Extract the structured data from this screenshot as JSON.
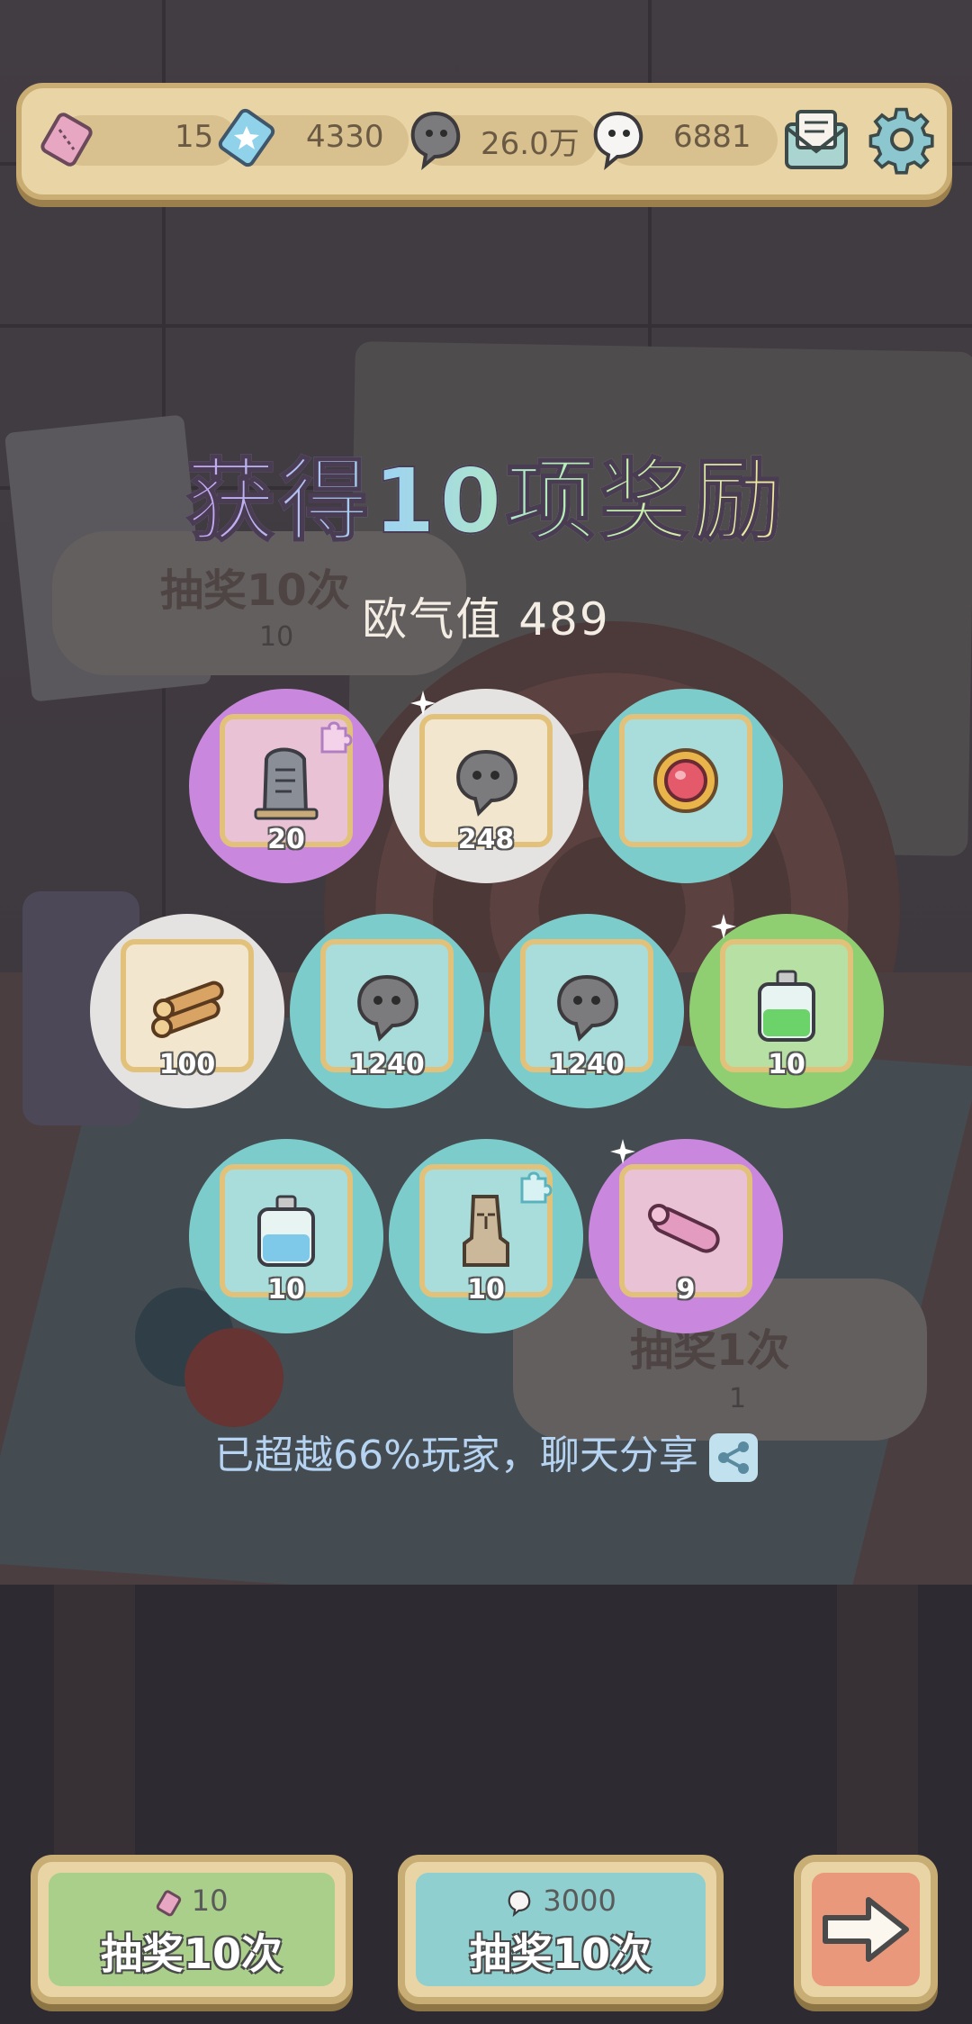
{
  "top_bar": {
    "ticket_value": "15",
    "star_ticket_value": "4330",
    "dark_bubble_value": "26.0万",
    "white_bubble_value": "6881",
    "icons": [
      "ticket-icon",
      "star-ticket-icon",
      "dark-bubble-icon",
      "white-bubble-icon",
      "mail-icon",
      "gear-icon"
    ]
  },
  "background_signs": {
    "left_title": "抽奖10次",
    "left_cost": "10",
    "right_title": "抽奖1次",
    "right_cost": "1"
  },
  "popup": {
    "title": "获得10项奖励",
    "luck_label": "欧气值 489",
    "rewards": [
      {
        "item": "stone-tablet",
        "quantity": "20",
        "rarity": "purple"
      },
      {
        "item": "dark-bubble",
        "quantity": "248",
        "rarity": "white"
      },
      {
        "item": "gem-brooch",
        "quantity": "",
        "rarity": "teal"
      },
      {
        "item": "wood-logs",
        "quantity": "100",
        "rarity": "white"
      },
      {
        "item": "dark-bubble",
        "quantity": "1240",
        "rarity": "teal"
      },
      {
        "item": "dark-bubble",
        "quantity": "1240",
        "rarity": "teal"
      },
      {
        "item": "green-potion",
        "quantity": "10",
        "rarity": "green"
      },
      {
        "item": "blue-potion",
        "quantity": "10",
        "rarity": "teal"
      },
      {
        "item": "moai-statue",
        "quantity": "10",
        "rarity": "teal"
      },
      {
        "item": "pink-scroll",
        "quantity": "9",
        "rarity": "purple"
      }
    ],
    "share_text": "已超越66%玩家，聊天分享"
  },
  "buttons": {
    "draw_ticket": {
      "cost": "10",
      "label": "抽奖10次"
    },
    "draw_bubble": {
      "cost": "3000",
      "label": "抽奖10次"
    }
  },
  "colors": {
    "purple": "#c987dd",
    "white": "#e5e3e2",
    "teal": "#7dcccc",
    "green": "#8fcf72",
    "panel": "#e9d4a6"
  }
}
